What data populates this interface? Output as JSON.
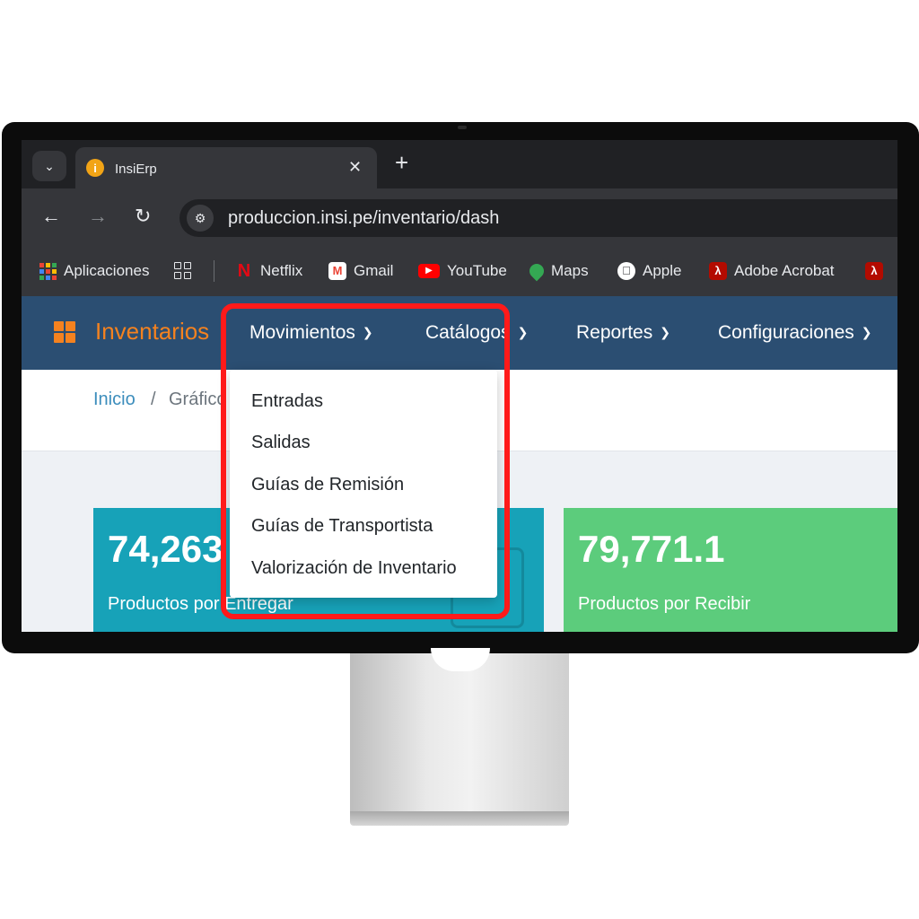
{
  "browser": {
    "tab_menu_icon": "chevron-down-icon",
    "tab_title": "InsiErp",
    "tab_favicon_letter": "i",
    "url": "produccion.insi.pe/inventario/dash"
  },
  "bookmarks": [
    {
      "label": "Aplicaciones",
      "icon": "apps-dots-icon"
    },
    {
      "label": "Netflix",
      "icon": "netflix-icon",
      "color": "#e50914"
    },
    {
      "label": "Gmail",
      "icon": "gmail-icon"
    },
    {
      "label": "YouTube",
      "icon": "youtube-icon",
      "color": "#ff0000"
    },
    {
      "label": "Maps",
      "icon": "maps-pin-icon"
    },
    {
      "label": "Apple",
      "icon": "apple-icon"
    },
    {
      "label": "Adobe Acrobat",
      "icon": "acrobat-icon",
      "color": "#b30b00"
    }
  ],
  "app": {
    "brand": "Inventarios",
    "menu": [
      {
        "label": "Movimientos"
      },
      {
        "label": "Catálogos"
      },
      {
        "label": "Reportes"
      },
      {
        "label": "Configuraciones"
      }
    ],
    "breadcrumb": {
      "home": "Inicio",
      "separator": "/",
      "current": "Gráfico"
    },
    "dropdown": [
      "Entradas",
      "Salidas",
      "Guías de Remisión",
      "Guías de Transportista",
      "Valorización de Inventario"
    ],
    "cards": [
      {
        "value": "74,263",
        "label": "Productos por Entregar"
      },
      {
        "value": "79,771.1",
        "label": "Productos por Recibir"
      }
    ]
  },
  "colors": {
    "navbar": "#2b4e72",
    "brand_accent": "#f5821f",
    "card_teal": "#17a2b8",
    "card_green": "#5ccc7c",
    "highlight": "#ff1a1a"
  }
}
